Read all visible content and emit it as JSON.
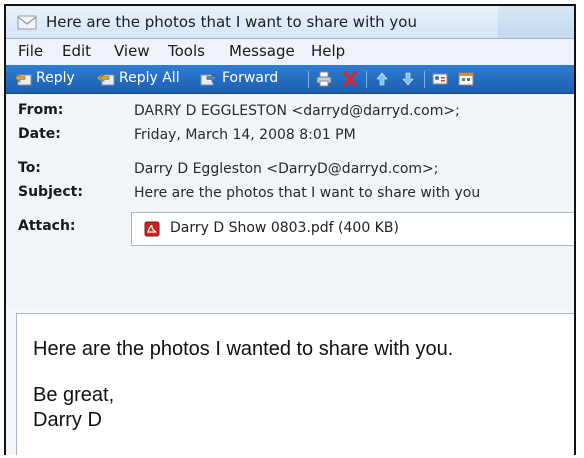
{
  "window": {
    "title": "Here are the photos that I want to share with you",
    "icon": "envelope-icon"
  },
  "menu": [
    "File",
    "Edit",
    "View",
    "Tools",
    "Message",
    "Help"
  ],
  "toolbar": {
    "reply": "Reply",
    "reply_all": "Reply All",
    "forward": "Forward",
    "icons": [
      "reply-icon",
      "reply-all-icon",
      "forward-icon",
      "print-icon",
      "delete-icon",
      "previous-icon",
      "next-icon",
      "address-book-icon",
      "calendar-icon"
    ]
  },
  "headers": {
    "from_label": "From:",
    "from_value": "DARRY D EGGLESTON <darryd@darryd.com>;",
    "date_label": "Date:",
    "date_value": "Friday, March 14, 2008 8:01 PM",
    "to_label": "To:",
    "to_value": "Darry D Eggleston <DarryD@darryd.com>;",
    "subject_label": "Subject:",
    "subject_value": "Here are the photos that I want to share with you",
    "attach_label": "Attach:",
    "attachment": "Darry D Show 0803.pdf (400 KB)"
  },
  "body": {
    "line1": "Here are the photos I wanted to share with you.",
    "line2": "Be great,",
    "line3": "Darry D"
  },
  "colors": {
    "toolbar": "#2569bf",
    "titlebar": "#d5e5f6",
    "header_bg": "#f1f4f8"
  }
}
